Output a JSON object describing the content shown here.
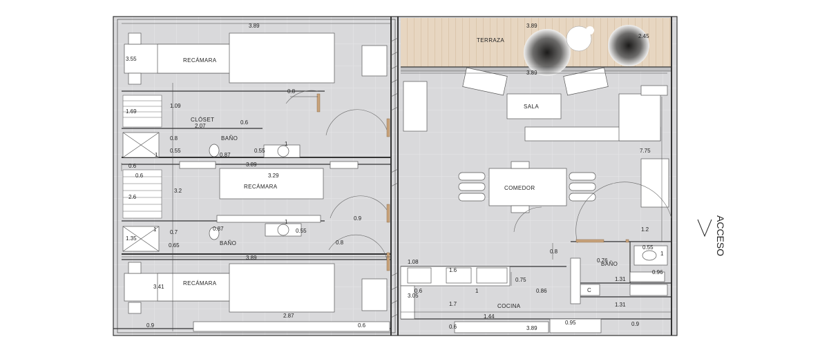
{
  "rooms": {
    "terraza": "TERRAZA",
    "sala": "SALA",
    "comedor": "COMEDOR",
    "cocina": "COCINA",
    "recamara_1": "RECÁMARA",
    "recamara_2": "RECÁMARA",
    "recamara_3": "RECÁMARA",
    "closet": "CLÓSET",
    "bano_1": "BAÑO",
    "bano_2": "BAÑO",
    "bano_3": "BAÑO"
  },
  "access_label": "ACCESO",
  "dimensions": {
    "top_left_width": "3.89",
    "terrace_width": "3.89",
    "terrace_right": "2.45",
    "sala_width": "3.89",
    "rec1_depth": "3.55",
    "rec1_door": "0.8",
    "closet_h": "1.69",
    "closet_w1": "1.09",
    "closet_w2": "2.07",
    "closet_small": "0.6",
    "bath1_a": "0.8",
    "bath1_b": "0.55",
    "bath1_c": "0.55",
    "bath1_d": "1",
    "bath1_e": "1",
    "bath1_f": "0.87",
    "mid_left_a": "0.6",
    "mid_left_b": "0.6",
    "rec2_width": "3.89",
    "rec2_inner": "3.29",
    "rec2_depth": "3.2",
    "rec2_left": "2.6",
    "rec2_door": "0.9",
    "bath2_a": "1",
    "bath2_b": "0.7",
    "bath2_c": "0.87",
    "bath2_d": "1",
    "bath2_e": "0.55",
    "bath2_f": "1.35",
    "bath2_g": "0.65",
    "bath2_h": "0.8",
    "rec3_width": "3.89",
    "rec3_depth": "3.41",
    "bottom_a": "0.9",
    "bottom_b": "2.87",
    "bottom_c": "0.6",
    "living_depth": "7.75",
    "access_w": "1.2",
    "hall_a": "0.8",
    "bath3_a": "0.55",
    "bath3_b": "1",
    "bath3_c": "0.76",
    "bath3_d": "0.96",
    "bath3_e": "1.31",
    "bath3_f": "1.31",
    "bath3_g": "0.9",
    "bath3_h": "0.95",
    "kit_a": "1.08",
    "kit_b": "1.6",
    "kit_c": "0.75",
    "kit_d": "0.6",
    "kit_e": "1",
    "kit_f": "0.86",
    "kit_g": "3.05",
    "kit_h": "1.7",
    "kit_i": "1.44",
    "kit_j": "0.6",
    "kit_k": "3.89"
  },
  "appliance_c": "C",
  "colors": {
    "floor": "#d8d8da",
    "wall": "#3a3a3a",
    "terrace": "#e6d3bd",
    "furniture": "#ffffff",
    "door_jamb": "#c8a27a"
  }
}
